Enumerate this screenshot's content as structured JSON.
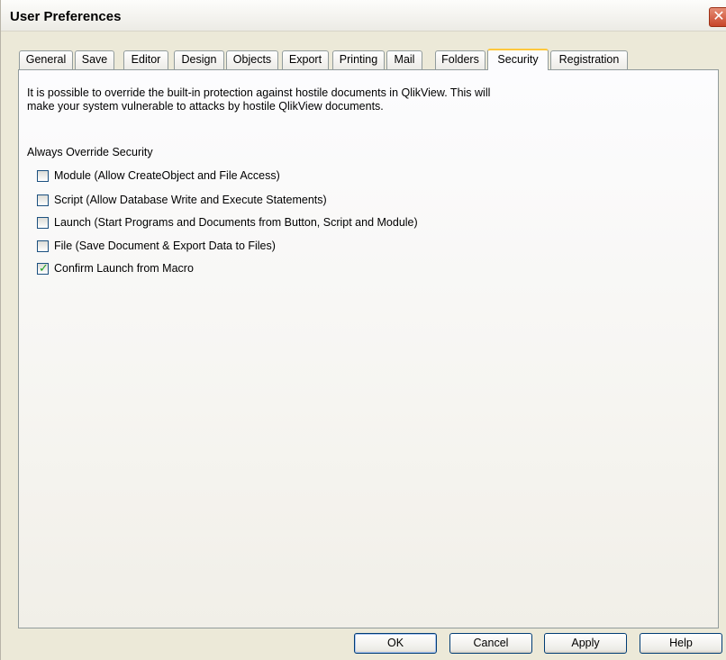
{
  "window": {
    "title": "User Preferences",
    "close_glyph": "✕"
  },
  "tabs": [
    {
      "label": "General",
      "active": false
    },
    {
      "label": "Save",
      "active": false
    },
    {
      "label": "Editor",
      "active": false
    },
    {
      "label": "Design",
      "active": false
    },
    {
      "label": "Objects",
      "active": false
    },
    {
      "label": "Export",
      "active": false
    },
    {
      "label": "Printing",
      "active": false
    },
    {
      "label": "Mail",
      "active": false
    },
    {
      "label": "Folders",
      "active": false
    },
    {
      "label": "Security",
      "active": true
    },
    {
      "label": "Registration",
      "active": false
    }
  ],
  "security": {
    "description_line1": "It is possible to override the built-in protection against hostile documents in QlikView. This will",
    "description_line2": "make your system vulnerable to attacks by hostile QlikView documents.",
    "group_label": "Always Override Security",
    "checkboxes": [
      {
        "label": "Module (Allow CreateObject and File Access)",
        "checked": false
      },
      {
        "label": "Script (Allow Database Write and Execute Statements)",
        "checked": false
      },
      {
        "label": "Launch (Start Programs and Documents from Button, Script and Module)",
        "checked": false
      },
      {
        "label": "File (Save Document & Export Data to Files)",
        "checked": false
      },
      {
        "label": "Confirm Launch from Macro",
        "checked": true
      }
    ],
    "check_glyph": "✓"
  },
  "buttons": {
    "ok": "OK",
    "cancel": "Cancel",
    "apply": "Apply",
    "help": "Help"
  }
}
